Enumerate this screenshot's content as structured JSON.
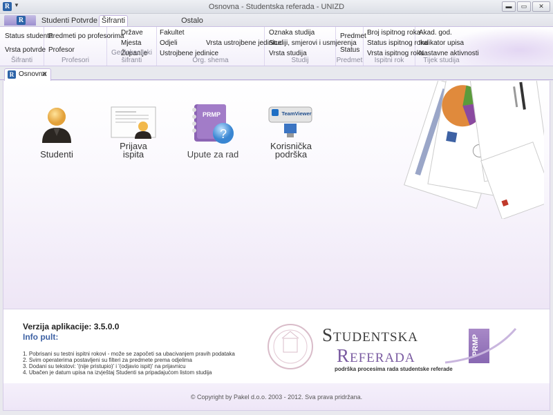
{
  "window": {
    "title": "Osnovna - Studentska referada - UNIZD",
    "min": "▬",
    "max": "▭",
    "close": "✕"
  },
  "tabs": [
    {
      "label": "Studenti"
    },
    {
      "label": "Potvrde"
    },
    {
      "label": "Šifranti"
    },
    {
      "label": "Ostalo"
    }
  ],
  "ribbon": {
    "sifranti": {
      "items": [
        "Status studenta",
        "Vrsta potvrde"
      ],
      "label": "Šifranti"
    },
    "profesori": {
      "items": [
        "Predmeti po profesorima",
        "Profesor"
      ],
      "label": "Profesori"
    },
    "geo": {
      "items": [
        "Države",
        "Mjesta",
        "Županije"
      ],
      "label": "Geolokacijski šifranti"
    },
    "org": {
      "items": [
        "Fakultet",
        "Odjeli",
        "Ustrojbene jedinice",
        "Vrsta ustrojbene jedinice"
      ],
      "label": "Org. shema"
    },
    "studij": {
      "items": [
        "Oznaka studija",
        "Studiji, smjerovi i usmjerenja",
        "Vrsta studija"
      ],
      "label": "Studij"
    },
    "predmet": {
      "items": [
        "Predmet",
        "Status"
      ],
      "label": "Predmet"
    },
    "ispitni": {
      "items": [
        "Broj ispitnog roka",
        "Status ispitnog roka",
        "Vrsta ispitnog roka"
      ],
      "label": "Ispitni rok"
    },
    "tijek": {
      "items": [
        "Akad. god.",
        "Indikator upisa",
        "Nastavne aktivnosti"
      ],
      "label": "Tijek studija"
    }
  },
  "doctab": {
    "label": "Osnovna",
    "close": "✕"
  },
  "launchers": {
    "studenti": "Studenti",
    "prijava1": "Prijava",
    "prijava2": "ispita",
    "upute": "Upute za rad",
    "kor1": "Korisnička",
    "kor2": "podrška",
    "upute_badge": "PRMP",
    "teamviewer": "TeamViewer"
  },
  "info": {
    "version": "Verzija aplikacije: 3.5.0.0",
    "pult": "Info pult:",
    "notes": [
      "1. Pobrisani su testni ispitni rokovi - može se započeti sa ubacivanjem pravih podataka",
      "2. Svim operaterima postavljeni su filteri za predmete prema odjelima",
      "3. Dodani su tekstovi: '(nije pristupio)' i '(odjavio ispit)' na prijavnicu",
      "4. Ubačen je datum upisa na izvještaj Studenti sa pripadajućom listom studija"
    ]
  },
  "brand": {
    "line1": "Studentska",
    "line2": "Referada",
    "tagline": "podrška procesima rada studentske referade",
    "tag": "PRMP"
  },
  "footer": {
    "copyright": "© Copyright by Pakel d.o.o. 2003 - 2012. Sva prava pridržana."
  },
  "colors": {
    "accent": "#7a5ba1",
    "link": "#3e62a4",
    "logo": "#2d64a8"
  }
}
